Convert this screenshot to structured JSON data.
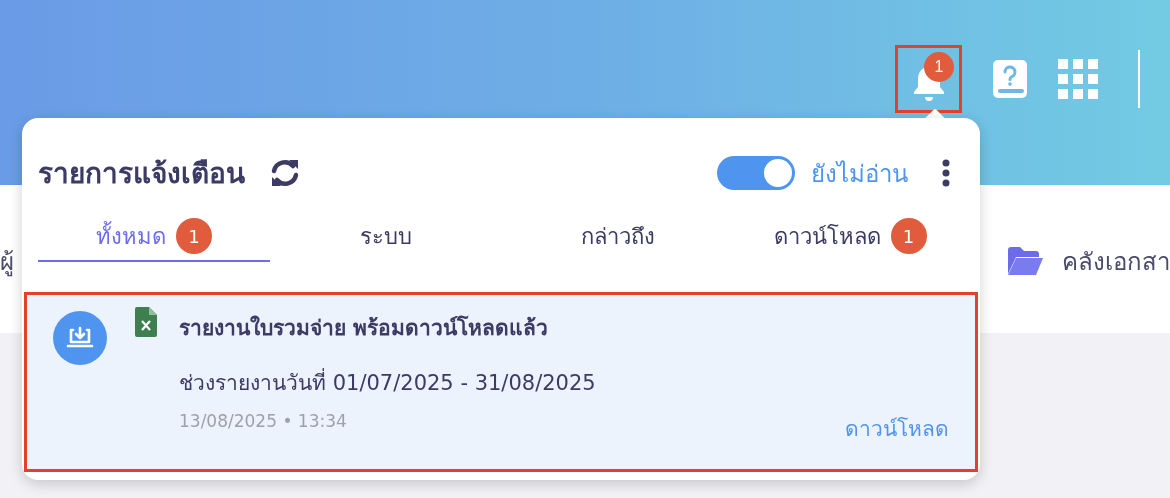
{
  "header": {
    "bell": {
      "badge": "1",
      "highlighted": true
    }
  },
  "background_items": [
    {
      "label": "ผู้",
      "kind": "text"
    },
    {
      "label": "คลังเอกสา",
      "kind": "folder"
    }
  ],
  "panel": {
    "title": "รายการแจ้งเตือน",
    "unread_only": {
      "label": "ยังไม่อ่าน",
      "on": true
    },
    "tabs": [
      {
        "label": "ทั้งหมด",
        "badge": "1",
        "selected": true
      },
      {
        "label": "ระบบ",
        "selected": false
      },
      {
        "label": "กล่าวถึง",
        "selected": false
      },
      {
        "label": "ดาวน์โหลด",
        "badge": "1",
        "selected": false
      }
    ],
    "notifications": [
      {
        "title": "รายงานใบรวมจ่าย พร้อมดาวน์โหลดแล้ว",
        "detail": "ช่วงรายงานวันที่ 01/07/2025 - 31/08/2025",
        "time": "13/08/2025 • 13:34",
        "action": "ดาวน์โหลด",
        "highlighted": true
      }
    ]
  }
}
